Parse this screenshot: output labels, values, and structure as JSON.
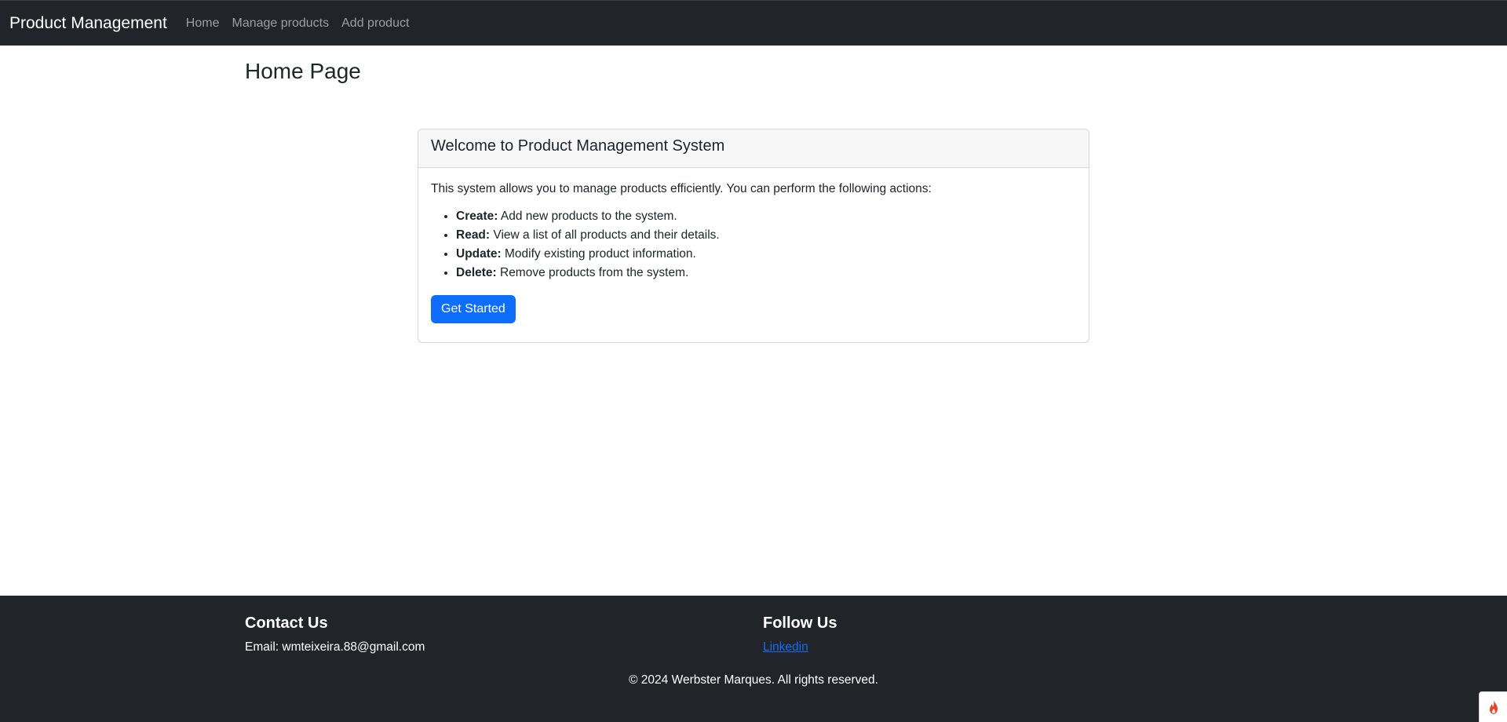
{
  "navbar": {
    "brand": "Product Management",
    "links": [
      {
        "label": "Home"
      },
      {
        "label": "Manage products"
      },
      {
        "label": "Add product"
      }
    ]
  },
  "main": {
    "title": "Home Page",
    "card": {
      "header": "Welcome to Product Management System",
      "intro": "This system allows you to manage products efficiently. You can perform the following actions:",
      "features": [
        {
          "label": "Create:",
          "text": " Add new products to the system."
        },
        {
          "label": "Read:",
          "text": " View a list of all products and their details."
        },
        {
          "label": "Update:",
          "text": " Modify existing product information."
        },
        {
          "label": "Delete:",
          "text": " Remove products from the system."
        }
      ],
      "button": "Get Started"
    }
  },
  "footer": {
    "contact": {
      "heading": "Contact Us",
      "email": "Email: wmteixeira.88@gmail.com"
    },
    "follow": {
      "heading": "Follow Us",
      "link": "Linkedin"
    },
    "copyright": "© 2024 Werbster Marques. All rights reserved."
  },
  "widget": {
    "icon": "flame-icon"
  },
  "colors": {
    "navbar_bg": "#212529",
    "primary": "#0d6efd",
    "card_header_bg": "#f7f7f7"
  }
}
